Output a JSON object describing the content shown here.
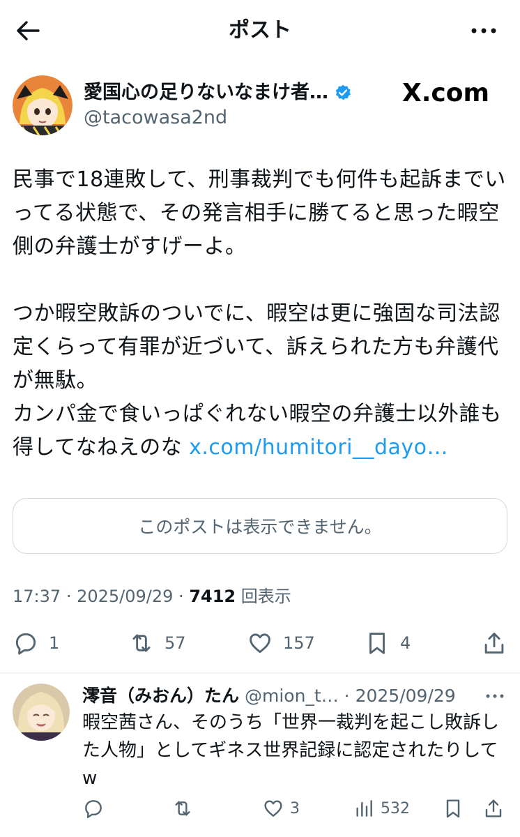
{
  "header": {
    "title": "ポスト",
    "back_icon": "arrow-left-icon",
    "more_icon": "more-horizontal-icon"
  },
  "author": {
    "display_name": "愛国心の足りないなまけ者…",
    "handle": "@tacowasa2nd",
    "verified": true,
    "verified_color": "#1d9bf0"
  },
  "watermark": "X.com",
  "tweet": {
    "paragraphs": [
      "民事で18連敗して、刑事裁判でも何件も起訴までいってる状態で、その発言相手に勝てると思った暇空側の弁護士がすげーよ。",
      "つか暇空敗訴のついでに、暇空は更に強固な司法認定くらって有罪が近づいて、訴えられた方も弁護代が無駄。\nカンパ金で食いっぱぐれない暇空の弁護士以外誰も得してなねえのな "
    ],
    "link_text": "x.com/humitori__dayo…",
    "link_color": "#1d9bf0"
  },
  "quote_unavailable": "このポストは表示できません。",
  "meta": {
    "time": "17:37",
    "date": "2025/09/29",
    "views": "7412",
    "views_label": "回表示"
  },
  "actions": {
    "replies": "1",
    "reposts": "57",
    "likes": "157",
    "bookmarks": "4"
  },
  "reply": {
    "display_name": "澪音（みおん）たん",
    "handle": "@mion_t…",
    "date": "2025/09/29",
    "text": "暇空茜さん、そのうち「世界一裁判を起こし敗訴した人物」としてギネス世界記録に認定されたりしてw",
    "actions": {
      "replies": "",
      "reposts": "",
      "likes": "3",
      "views": "532"
    }
  },
  "colors": {
    "text": "#0f1419",
    "secondary": "#536471",
    "border": "#cfd9de",
    "accent": "#1d9bf0"
  }
}
